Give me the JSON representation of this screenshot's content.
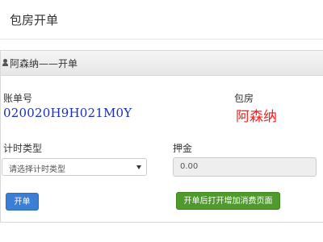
{
  "page": {
    "title": "包房开单"
  },
  "panel": {
    "title": "阿森纳——开单",
    "icon": "user-icon"
  },
  "account": {
    "label": "账单号",
    "value": "020020H9H021M0Y"
  },
  "room": {
    "label": "包房",
    "value": "阿森纳"
  },
  "timing_type": {
    "label": "计时类型",
    "selected": "请选择计时类型"
  },
  "deposit": {
    "label": "押金",
    "value": "0.00"
  },
  "buttons": {
    "open": "开单",
    "open_and_order": "开单后打开增加消费页面"
  },
  "colors": {
    "account_value": "#1a2fb6",
    "room_value": "#ff1a1a",
    "primary_button": "#3a7fd5",
    "success_button": "#4e9a2b"
  }
}
